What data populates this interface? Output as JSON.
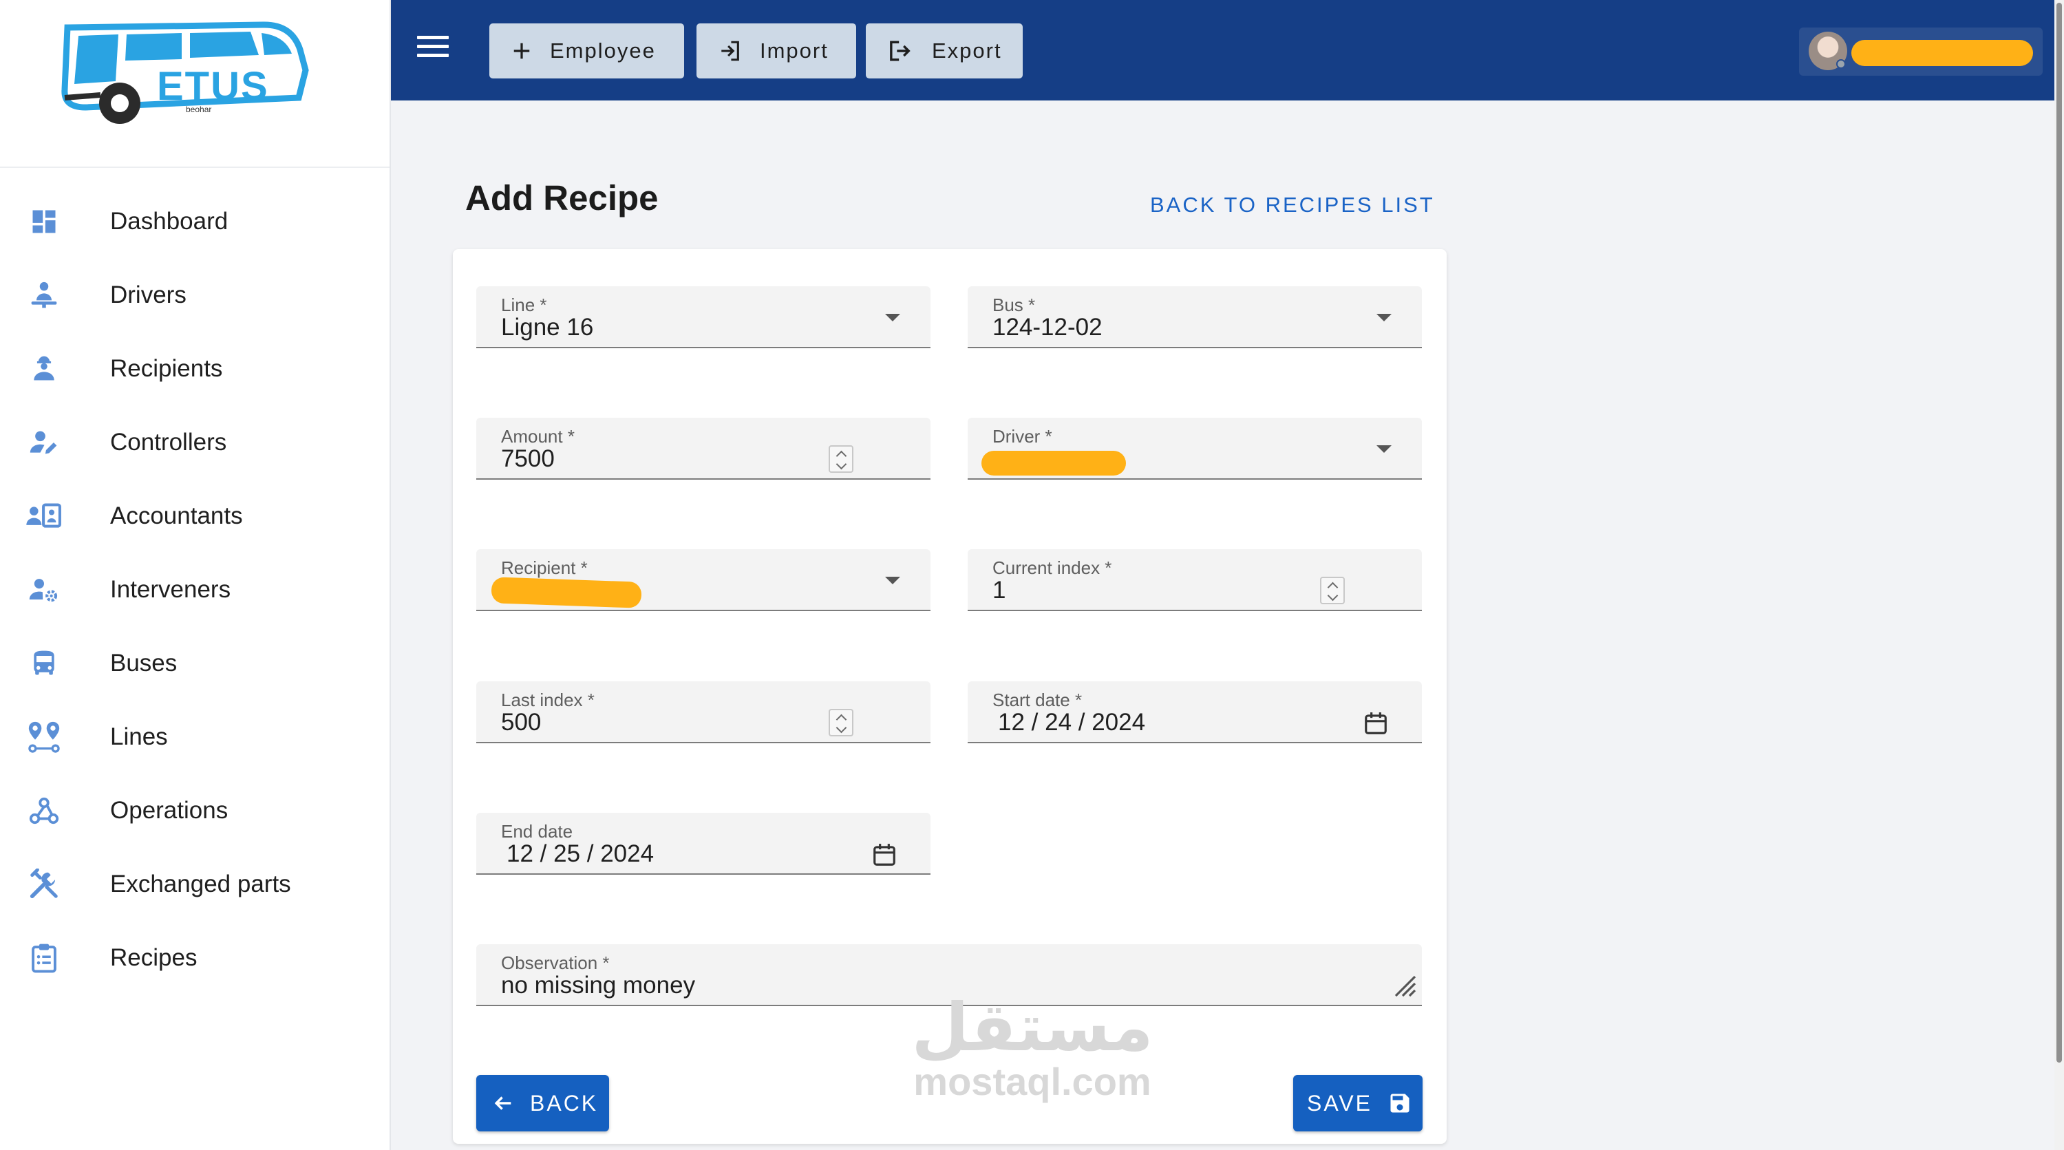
{
  "logo": {
    "brand": "ETUS",
    "tagline": "beohar",
    "color": "#2aa3e2"
  },
  "sidebar": {
    "icon_color": "#5b8fd6",
    "items": [
      {
        "label": "Dashboard",
        "icon": "dashboard-icon"
      },
      {
        "label": "Drivers",
        "icon": "driver-person-icon"
      },
      {
        "label": "Recipients",
        "icon": "worker-person-icon"
      },
      {
        "label": "Controllers",
        "icon": "person-edit-icon"
      },
      {
        "label": "Accountants",
        "icon": "contact-card-icon"
      },
      {
        "label": "Interveners",
        "icon": "person-gear-icon"
      },
      {
        "label": "Buses",
        "icon": "bus-icon"
      },
      {
        "label": "Lines",
        "icon": "route-pins-icon"
      },
      {
        "label": "Operations",
        "icon": "webhook-icon"
      },
      {
        "label": "Exchanged parts",
        "icon": "tools-icon"
      },
      {
        "label": "Recipes",
        "icon": "clipboard-list-icon"
      }
    ]
  },
  "topbar": {
    "background": "#153e86",
    "buttons": {
      "employee": "Employee",
      "import": "Import",
      "export": "Export"
    },
    "user": {
      "name": ""
    }
  },
  "page": {
    "title": "Add Recipe",
    "back_link": "BACK TO RECIPES LIST"
  },
  "form": {
    "line": {
      "label": "Line *",
      "value": "Ligne 16"
    },
    "bus": {
      "label": "Bus *",
      "value": "124-12-02"
    },
    "amount": {
      "label": "Amount *",
      "value": "7500"
    },
    "driver": {
      "label": "Driver *",
      "value": ""
    },
    "recipient": {
      "label": "Recipient *",
      "value": ""
    },
    "current_index": {
      "label": "Current index *",
      "value": "1"
    },
    "last_index": {
      "label": "Last index *",
      "value": "500"
    },
    "start_date": {
      "label": "Start date *",
      "value": "12 / 24 / 2024"
    },
    "end_date": {
      "label": "End date",
      "value": "12 / 25 / 2024"
    },
    "observation": {
      "label": "Observation *",
      "value": "no missing money"
    }
  },
  "actions": {
    "back": "BACK",
    "save": "SAVE",
    "accent": "#1560c0"
  },
  "watermark": {
    "arabic": "مستقل",
    "latin": "mostaql.com"
  }
}
